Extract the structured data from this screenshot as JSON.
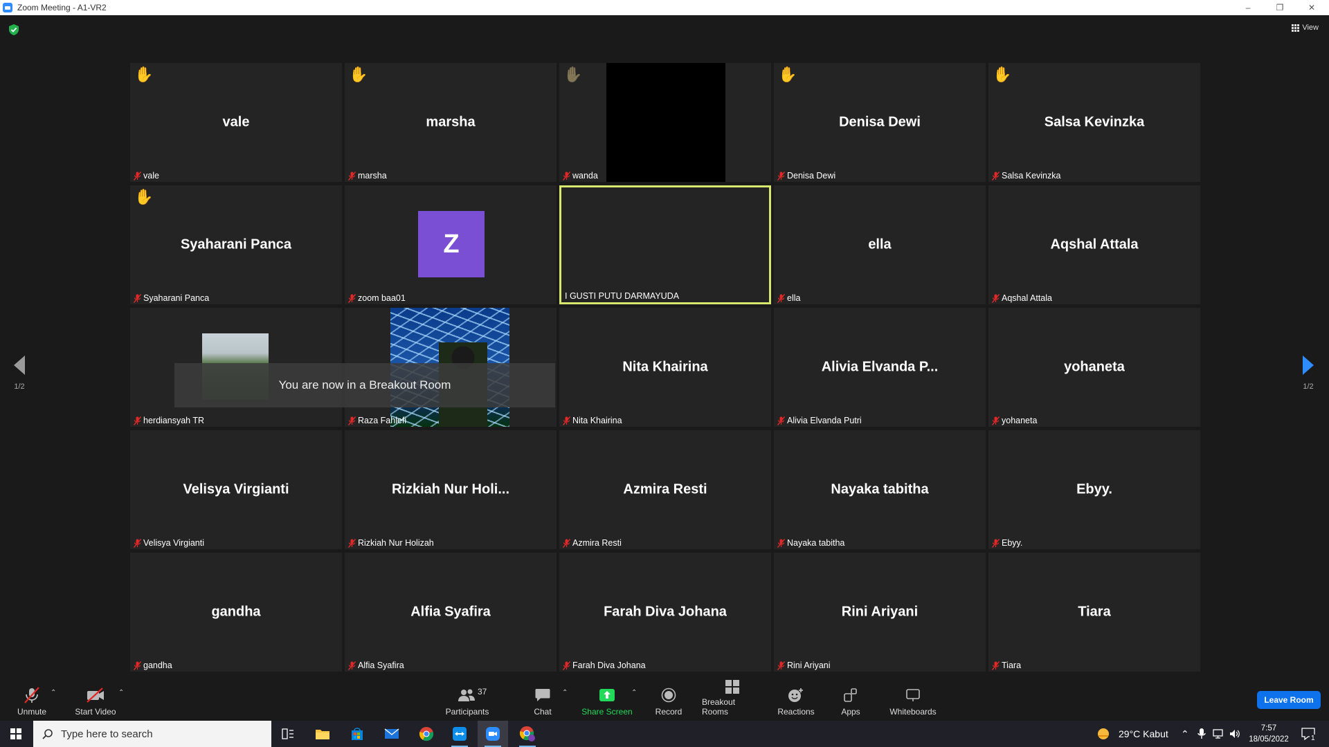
{
  "window": {
    "title": "Zoom Meeting - A1-VR2"
  },
  "toolbar_top": {
    "view_label": "View"
  },
  "pagination": {
    "left": "1/2",
    "right": "1/2"
  },
  "toast": {
    "text": "You are now in a Breakout Room"
  },
  "tiles": [
    {
      "display": "vale",
      "label": "vale",
      "hand": true
    },
    {
      "display": "marsha",
      "label": "marsha",
      "hand": true
    },
    {
      "display": "",
      "label": "wanda",
      "hand": true,
      "hand_faded": true,
      "video": "black"
    },
    {
      "display": "Denisa Dewi",
      "label": "Denisa Dewi",
      "hand": true
    },
    {
      "display": "Salsa Kevinzka",
      "label": "Salsa Kevinzka",
      "hand": true
    },
    {
      "display": "Syaharani Panca",
      "label": "Syaharani Panca",
      "hand": true
    },
    {
      "display": "",
      "label": "zoom baa01",
      "avatar_letter": "Z"
    },
    {
      "display": "",
      "label": "I GUSTI PUTU DARMAYUDA",
      "active": true,
      "muted": false
    },
    {
      "display": "ella",
      "label": "ella"
    },
    {
      "display": "Aqshal Attala",
      "label": "Aqshal Attala"
    },
    {
      "display": "",
      "label": "herdiansyah TR",
      "video": "mountain"
    },
    {
      "display": "",
      "label": "Raza Fahlefi",
      "video": "blue"
    },
    {
      "display": "Nita Khairina",
      "label": "Nita Khairina"
    },
    {
      "display": "Alivia Elvanda P...",
      "label": "Alivia Elvanda Putri"
    },
    {
      "display": "yohaneta",
      "label": "yohaneta"
    },
    {
      "display": "Velisya Virgianti",
      "label": "Velisya Virgianti"
    },
    {
      "display": "Rizkiah Nur Holi...",
      "label": "Rizkiah Nur Holizah"
    },
    {
      "display": "Azmira Resti",
      "label": "Azmira Resti"
    },
    {
      "display": "Nayaka tabitha",
      "label": "Nayaka tabitha"
    },
    {
      "display": "Ebyy.",
      "label": "Ebyy."
    },
    {
      "display": "gandha",
      "label": "gandha"
    },
    {
      "display": "Alfia Syafira",
      "label": "Alfia Syafira"
    },
    {
      "display": "Farah Diva Johana",
      "label": "Farah Diva Johana"
    },
    {
      "display": "Rini Ariyani",
      "label": "Rini Ariyani"
    },
    {
      "display": "Tiara",
      "label": "Tiara"
    }
  ],
  "controls": {
    "unmute": "Unmute",
    "start_video": "Start Video",
    "participants": "Participants",
    "participants_count": "37",
    "chat": "Chat",
    "share_screen": "Share Screen",
    "record": "Record",
    "breakout_rooms": "Breakout Rooms",
    "reactions": "Reactions",
    "apps": "Apps",
    "whiteboards": "Whiteboards",
    "leave": "Leave Room"
  },
  "taskbar": {
    "search_placeholder": "Type here to search",
    "weather": "29°C  Kabut",
    "time": "7:57",
    "date": "18/05/2022",
    "notifications": "1"
  },
  "colors": {
    "accent": "#2d8cff",
    "active_speaker_border": "#d8e86e",
    "leave_button": "#0e72ed",
    "share_screen": "#23d959",
    "mic_off": "#e02828"
  }
}
